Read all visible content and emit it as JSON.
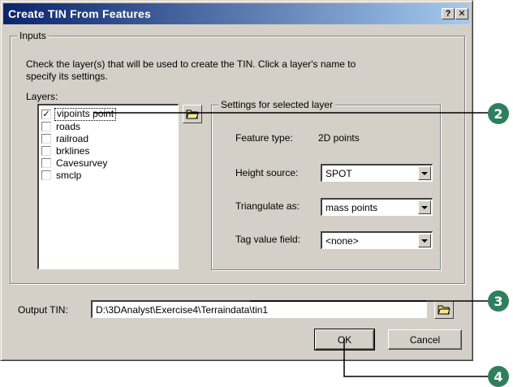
{
  "dialog": {
    "title": "Create TIN From Features",
    "help_label": "?",
    "close_label": "✕"
  },
  "inputs": {
    "group_label": "Inputs",
    "instruction_line1": "Check the layer(s) that will be used to create the TIN. Click a layer's name to",
    "instruction_line2": "specify its settings.",
    "layers_label": "Layers:",
    "layers": [
      {
        "label": "vipoints point",
        "checked": true,
        "selected": true
      },
      {
        "label": "roads",
        "checked": false
      },
      {
        "label": "railroad",
        "checked": false
      },
      {
        "label": "brklines",
        "checked": false
      },
      {
        "label": "Cavesurvey",
        "checked": false
      },
      {
        "label": "smclp",
        "checked": false
      }
    ],
    "check_mark": "✓"
  },
  "settings": {
    "group_label": "Settings for selected layer",
    "feature_type_label": "Feature type:",
    "feature_type_value": "2D points",
    "height_source_label": "Height source:",
    "height_source_value": "SPOT",
    "triangulate_label": "Triangulate as:",
    "triangulate_value": "mass points",
    "tag_value_label": "Tag value field:",
    "tag_value_value": "<none>"
  },
  "output": {
    "label": "Output TIN:",
    "value": "D:\\3DAnalyst\\Exercise4\\Terraindata\\tin1"
  },
  "buttons": {
    "ok": "OK",
    "cancel": "Cancel"
  },
  "callouts": [
    "2",
    "3",
    "4"
  ],
  "colors": {
    "callout": "#2f7f5f",
    "title_gradient_start": "#0a246a",
    "title_gradient_end": "#a6caf0",
    "dialog_face": "#d4d0c8"
  }
}
